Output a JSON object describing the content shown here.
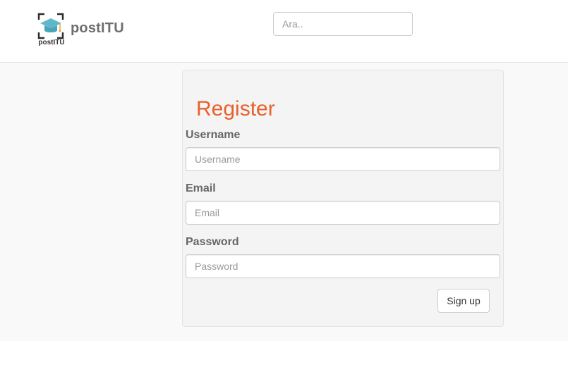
{
  "header": {
    "logo_text": "postITU",
    "brand_name": "postITU",
    "search": {
      "placeholder": "Ara..",
      "value": ""
    }
  },
  "form": {
    "title": "Register",
    "fields": [
      {
        "label": "Username",
        "placeholder": "Username",
        "value": ""
      },
      {
        "label": "Email",
        "placeholder": "Email",
        "value": ""
      },
      {
        "label": "Password",
        "placeholder": "Password",
        "value": ""
      }
    ],
    "submit_label": "Sign up"
  },
  "colors": {
    "accent": "#e8602c",
    "logo_cap": "#5fb8c9"
  },
  "icons": {
    "logo": "graduation-cap-icon"
  }
}
